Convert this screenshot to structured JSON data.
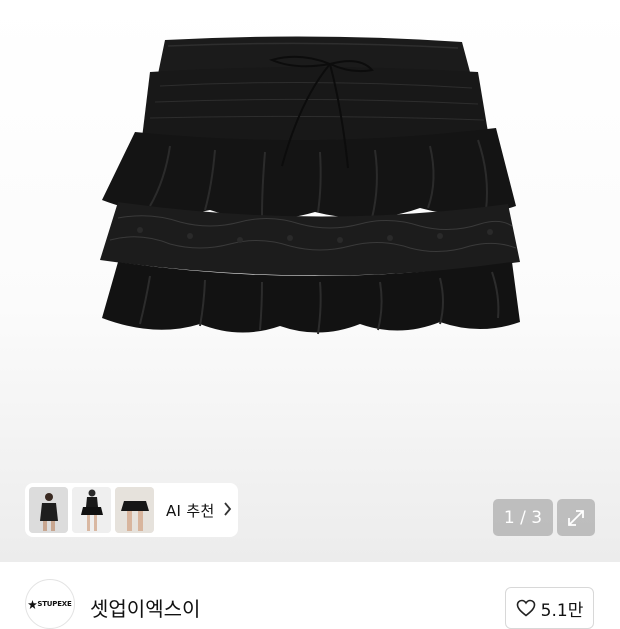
{
  "product": {
    "image_alt": "black tiered ruffle mini skirt with lace tiers and drawstring waist",
    "pager": "1 / 3"
  },
  "ai_recommend": {
    "label": "AI 추천",
    "thumbnails": [
      "model-photo-1",
      "model-photo-2",
      "model-photo-3"
    ]
  },
  "store": {
    "logo_text": "STUPEXE",
    "name": "셋업이엑스이",
    "like_count": "5.1만"
  },
  "icons": {
    "chevron": "chevron-right-icon",
    "expand": "expand-icon",
    "heart": "heart-icon"
  },
  "colors": {
    "skirt": "#141414",
    "overlay": "#9a9a9a"
  }
}
